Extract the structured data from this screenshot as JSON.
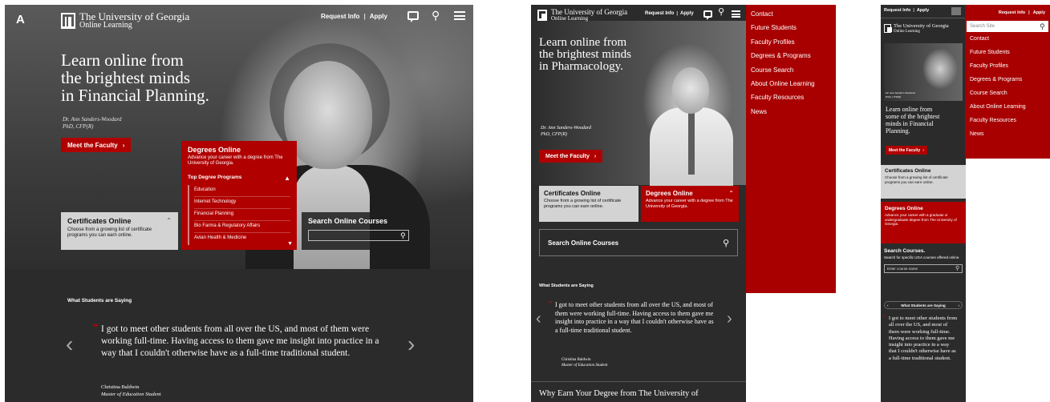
{
  "colors": {
    "brand_red": "#b00000",
    "dark_bg": "#2b2b2b",
    "light_panel": "#cfcfcf"
  },
  "desktop": {
    "logo_mark": "A",
    "logo_line1": "The University of Georgia",
    "logo_line2": "Online Learning",
    "request_info": "Request Info",
    "apply": "Apply",
    "chat_icon": "chat-icon",
    "hero_heading_lines": [
      "Learn online from",
      "the brightest minds",
      "in Financial Planning."
    ],
    "caption_name": "Dr. Ann Sanders-Woodard",
    "caption_credentials": "PhD, CFP(R)",
    "meet_faculty": "Meet the Faculty",
    "degrees": {
      "title": "Degrees Online",
      "desc": "Advance your career with a degree from The University of Georgia.",
      "top_programs_label": "Top Degree Programs",
      "programs": [
        "Education",
        "Internet Technology",
        "Financial Planning",
        "Bio Farma & Regulatory Affairs",
        "Avian Health & Medicine"
      ]
    },
    "certificates": {
      "title": "Certificates Online",
      "desc": "Choose from a growing list of certificate programs you can earn online."
    },
    "search": {
      "title": "Search Online Courses",
      "placeholder": ""
    },
    "testimonials": {
      "label": "What Students are Saying",
      "quote": "I got to meet other students from all over the US, and most of them were working full-time. Having access to them gave me insight into practice in a way that I couldn't otherwise have as a full-time traditional student.",
      "name": "Christina Baldwin",
      "role": "Master of Education Student"
    }
  },
  "tablet": {
    "logo_line1": "The University of Georgia",
    "logo_line2": "Online Learning",
    "request_info": "Request Info",
    "apply": "Apply",
    "hero_heading_lines": [
      "Learn online from",
      "the brightest minds",
      "in Pharmacology."
    ],
    "caption_name": "Dr. Ann Sanders-Woodard",
    "caption_credentials": "PhD, CFP(R)",
    "meet_faculty": "Meet the Faculty",
    "certificates": {
      "title": "Certificates Online",
      "desc": "Choose from a growing list of certificate programs you can earn online."
    },
    "degrees": {
      "title": "Degrees Online",
      "desc": "Advance your career with a degree from The University of Georgia."
    },
    "search_title": "Search Online Courses",
    "testimonials": {
      "label": "What Students are Saying",
      "quote": "I got to meet other students from all over the US, and most of them were working full-time. Having access to them gave me insight into practice in a way that I couldn't otherwise have as a full-time traditional student.",
      "name": "Christina Baldwin",
      "role": "Master of Education Student"
    },
    "bottom_heading": "Why Earn Your Degree from The University of",
    "menu": [
      "Contact",
      "Future Students",
      "Faculty Profiles",
      "Degrees & Programs",
      "Course Search",
      "About Online Learning",
      "Faculty Resources",
      "News"
    ]
  },
  "mobile": {
    "request_info": "Request Info",
    "apply": "Apply",
    "search_placeholder": "Search Site",
    "logo_line1": "The University of Georgia",
    "logo_line2": "Online Learning",
    "hero_heading_lines": [
      "Learn online from",
      "some of the brightest",
      "minds in Financial",
      "Planning."
    ],
    "caption_name": "Dr. Ann Sanders-Woodard",
    "caption_credentials": "PhD, CFP(R)",
    "meet_faculty": "Meet the Faculty",
    "certificates": {
      "title": "Certificates Online",
      "desc": "Choose from a growing list of certificate programs you can earn online."
    },
    "degrees": {
      "title": "Degrees Online",
      "desc": "Advance your career with a graduate or undergraduate degree from The University of Georgia."
    },
    "search": {
      "title": "Search Courses.",
      "desc": "Search for specific UGA courses offered online.",
      "placeholder": "Enter course name"
    },
    "testimonials_label": "What Students are Saying",
    "quote": "I got to meet other students from all over the US, and most of them were working full-time. Having access to them gave me insight into practice in a way that I couldn't otherwise have as a full-time traditional student.",
    "menu": [
      "Contact",
      "Future Students",
      "Faculty Profiles",
      "Degrees & Programs",
      "Course Search",
      "About Online Learning",
      "Faculty Resources",
      "News"
    ]
  }
}
